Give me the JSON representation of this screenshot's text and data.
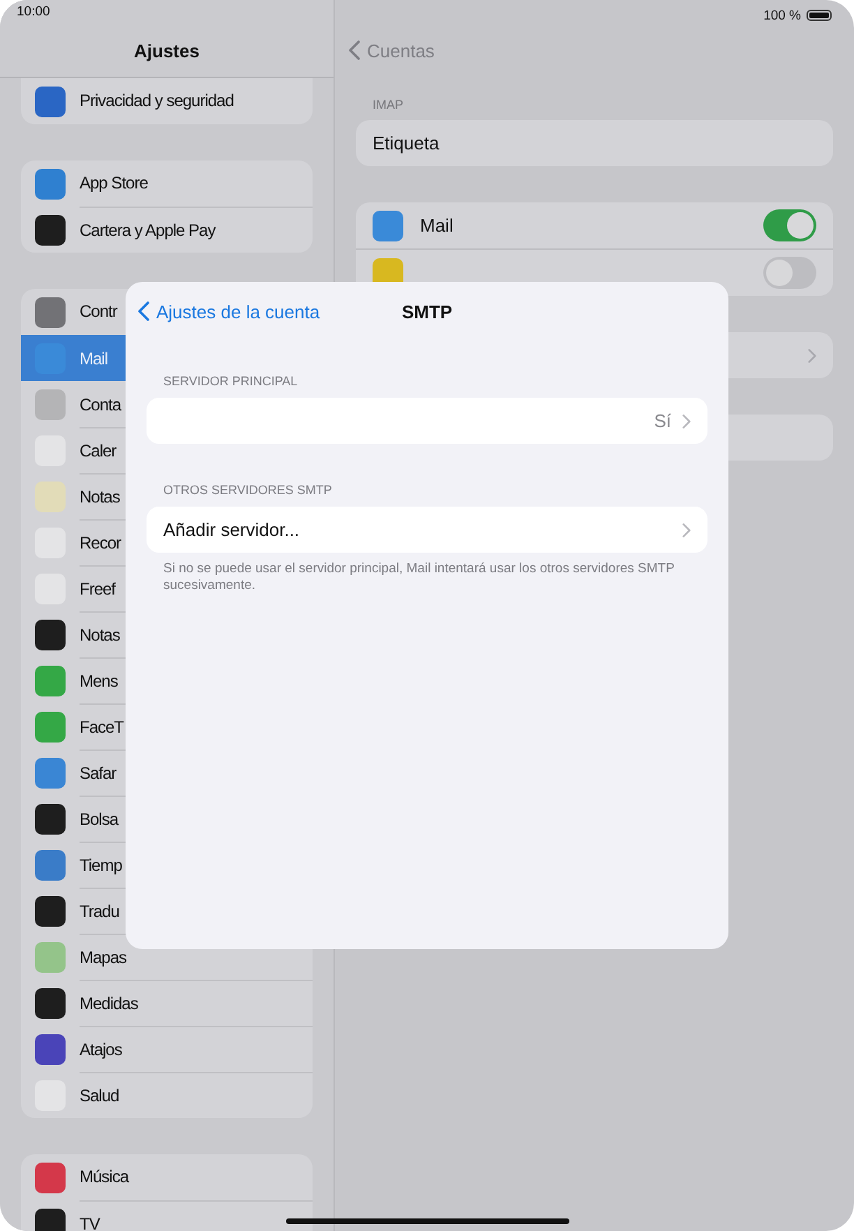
{
  "status_bar": {
    "time": "10:00",
    "battery": "100 %"
  },
  "sidebar": {
    "title": "Ajustes",
    "groups": [
      {
        "items": [
          {
            "label": "Privacidad y seguridad",
            "color": "#2a66c4",
            "selected": false
          }
        ]
      },
      {
        "items": [
          {
            "label": "App Store",
            "color": "#2f80d0",
            "selected": false
          },
          {
            "label": "Cartera y Apple Pay",
            "color": "#1e1e1e",
            "selected": false
          }
        ]
      },
      {
        "items": [
          {
            "label": "Contr",
            "color": "#727276",
            "selected": false
          },
          {
            "label": "Mail",
            "color": "#3a8ad8",
            "selected": true
          },
          {
            "label": "Conta",
            "color": "#b4b4b6",
            "selected": false
          },
          {
            "label": "Caler",
            "color": "#e4e4e6",
            "selected": false
          },
          {
            "label": "Notas",
            "color": "#e2dcb8",
            "selected": false
          },
          {
            "label": "Recor",
            "color": "#e4e4e6",
            "selected": false
          },
          {
            "label": "Freef",
            "color": "#e4e4e6",
            "selected": false
          },
          {
            "label": "Notas",
            "color": "#1e1e1e",
            "selected": false
          },
          {
            "label": "Mens",
            "color": "#34a846",
            "selected": false
          },
          {
            "label": "FaceT",
            "color": "#34a846",
            "selected": false
          },
          {
            "label": "Safar",
            "color": "#3a86d4",
            "selected": false
          },
          {
            "label": "Bolsa",
            "color": "#1e1e1e",
            "selected": false
          },
          {
            "label": "Tiemp",
            "color": "#3a7cc8",
            "selected": false
          },
          {
            "label": "Tradu",
            "color": "#1e1e1e",
            "selected": false
          },
          {
            "label": "Mapas",
            "color": "#94c48a",
            "selected": false
          },
          {
            "label": "Medidas",
            "color": "#1e1e1e",
            "selected": false
          },
          {
            "label": "Atajos",
            "color": "#4a44b8",
            "selected": false
          },
          {
            "label": "Salud",
            "color": "#e4e4e6",
            "selected": false
          }
        ]
      },
      {
        "items": [
          {
            "label": "Música",
            "color": "#d4384a",
            "selected": false
          },
          {
            "label": "TV",
            "color": "#1e1e1e",
            "selected": false
          }
        ]
      }
    ]
  },
  "detail": {
    "back": "Cuentas",
    "sections": [
      {
        "header": "IMAP",
        "rows": [
          {
            "kind": "text",
            "label": "Etiqueta"
          }
        ]
      },
      {
        "rows": [
          {
            "kind": "toggle",
            "label": "Mail",
            "color": "#3a8ad8",
            "on": true
          },
          {
            "kind": "toggle",
            "color": "#d8b820",
            "on": false
          }
        ]
      },
      {
        "rows": [
          {
            "kind": "link"
          }
        ]
      },
      {
        "rows": [
          {
            "kind": "blank"
          }
        ]
      }
    ]
  },
  "sheet": {
    "back": "Ajustes de la cuenta",
    "title": "SMTP",
    "sections": [
      {
        "header": "SERVIDOR PRINCIPAL",
        "rows": [
          {
            "value": "Sí"
          }
        ]
      },
      {
        "header": "OTROS SERVIDORES SMTP",
        "rows": [
          {
            "label": "Añadir servidor..."
          }
        ],
        "footer": "Si no se puede usar el servidor principal, Mail intentará usar los otros servidores SMTP sucesivamente."
      }
    ]
  }
}
